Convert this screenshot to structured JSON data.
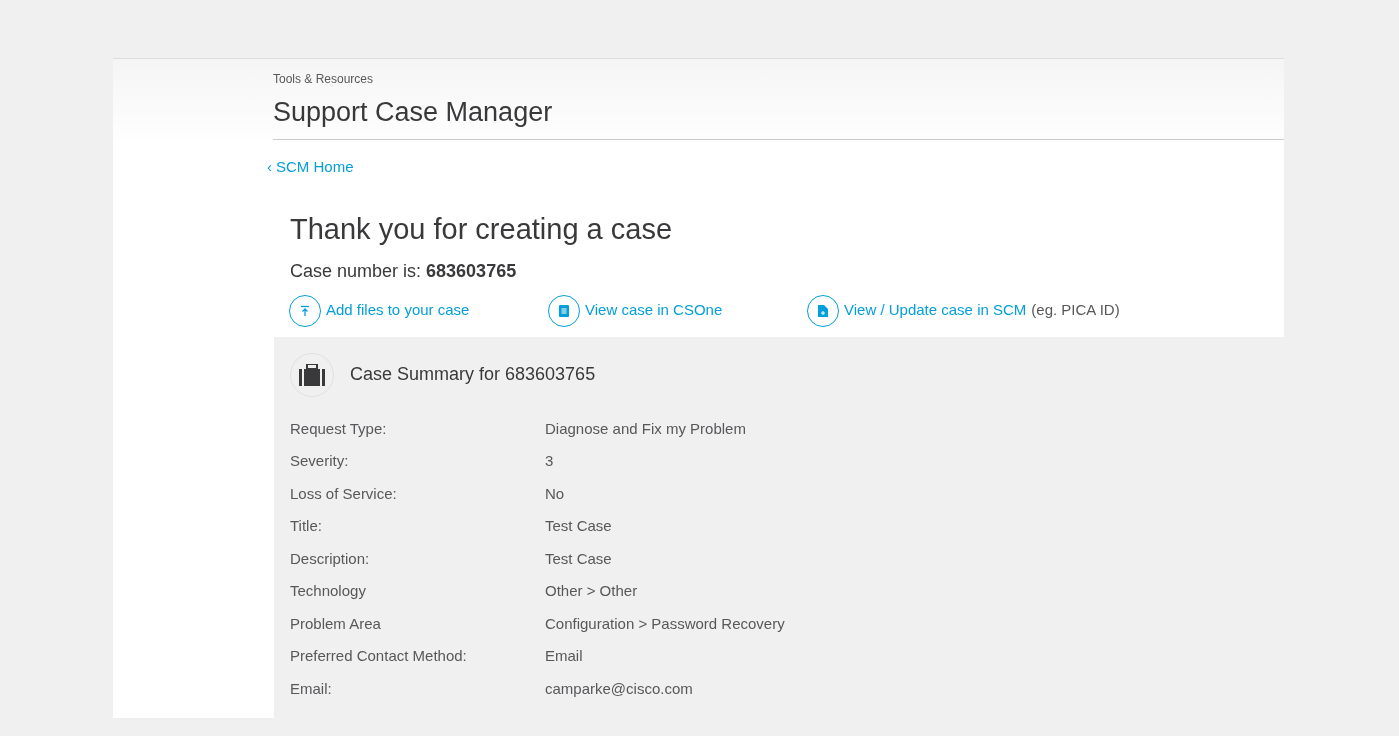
{
  "header": {
    "section": "Tools & Resources",
    "title": "Support Case Manager"
  },
  "back_link": {
    "icon": "‹",
    "label": "SCM Home"
  },
  "heading": "Thank you for creating a case",
  "case_number_line": "Case number is: **683603765**",
  "actions": [
    {
      "kind": "upload",
      "label": "Add files to your case"
    },
    {
      "kind": "document",
      "label": "View case in CSOne"
    },
    {
      "kind": "update",
      "label": "View / Update case in SCM",
      "note": "(eg. PICA ID)"
    }
  ],
  "summary": {
    "title": "Case Summary for 683603765",
    "rows": [
      {
        "label": "Request Type:",
        "value": "Diagnose and Fix my Problem"
      },
      {
        "label": "Severity:",
        "value": "3"
      },
      {
        "label": "Loss of Service:",
        "value": "No"
      },
      {
        "label": "Title:",
        "value": "Test Case"
      },
      {
        "label": "Description:",
        "value": "Test Case"
      },
      {
        "label": "Technology",
        "value": "Other > Other"
      },
      {
        "label": "Problem Area",
        "value": "Configuration > Password Recovery"
      },
      {
        "label": "Preferred Contact Method:",
        "value": "Email"
      },
      {
        "label": "Email:",
        "value": "camparke@cisco.com"
      }
    ]
  }
}
